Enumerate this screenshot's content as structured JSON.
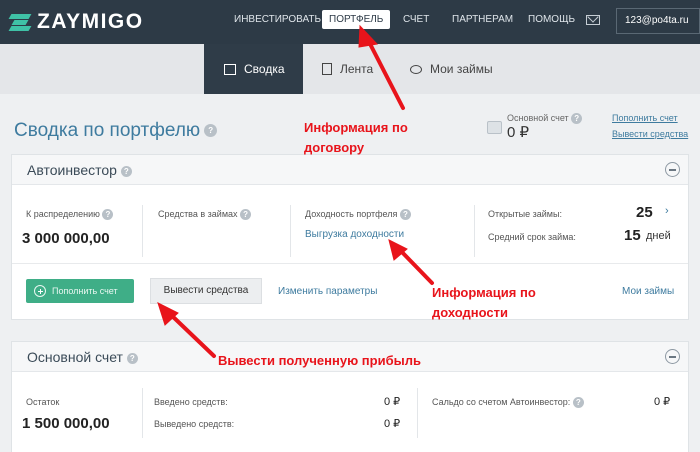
{
  "header": {
    "logo": "ZAYMIGO",
    "nav": [
      "ИНВЕСТИРОВАТЬ",
      "ПОРТФЕЛЬ",
      "СЧЕТ",
      "ПАРТНЕРАМ",
      "ПОМОЩЬ"
    ],
    "active_nav": "ПОРТФЕЛЬ",
    "user_email": "123@po4ta.ru"
  },
  "subnav": {
    "tabs": [
      "Сводка",
      "Лента",
      "Мои займы"
    ],
    "active_tab": "Сводка"
  },
  "page": {
    "title": "Сводка по портфелю",
    "main_account_label": "Основной счет",
    "main_account_value": "0 ₽",
    "topup_link": "Пополнить счет",
    "withdraw_link": "Вывести средства"
  },
  "autoinvestor": {
    "title": "Автоинвестор",
    "to_distribute_label": "К распределению",
    "to_distribute_value": "3 000 000,00",
    "in_loans_label": "Средства в займах",
    "yield_label": "Доходность портфеля",
    "yield_export_link": "Выгрузка доходности",
    "open_loans_label": "Открытые займы:",
    "open_loans_value": "25",
    "avg_term_label": "Средний срок займа:",
    "avg_term_value": "15",
    "avg_term_unit": "дней",
    "topup_button": "Пополнить счет",
    "withdraw_button": "Вывести средства",
    "change_params_link": "Изменить параметры",
    "my_loans_link": "Мои займы"
  },
  "main_account": {
    "title": "Основной счет",
    "balance_label": "Остаток",
    "balance_value": "1 500 000,00",
    "deposited_label": "Введено средств:",
    "deposited_value": "0 ₽",
    "withdrawn_label": "Выведено средств:",
    "withdrawn_value": "0 ₽",
    "saldo_label": "Сальдо со счетом Автоинвестор:",
    "saldo_value": "0 ₽"
  },
  "annotations": {
    "contract_info_1": "Информация по",
    "contract_info_2": "договору",
    "yield_info_1": "Информация по",
    "yield_info_2": "доходности",
    "withdraw_profit": "Вывести полученную прибыль"
  },
  "colors": {
    "nav_bg": "#2d3a46",
    "accent_blue": "#3e7b9f",
    "green_button": "#3fae87",
    "annotation_red": "#e8141b"
  },
  "icons": [
    "logo-icon",
    "mail-icon",
    "summary-icon",
    "feed-icon",
    "loans-icon",
    "wallet-icon",
    "help-icon",
    "collapse-icon",
    "plus-circle-icon",
    "chevron-right-icon"
  ]
}
